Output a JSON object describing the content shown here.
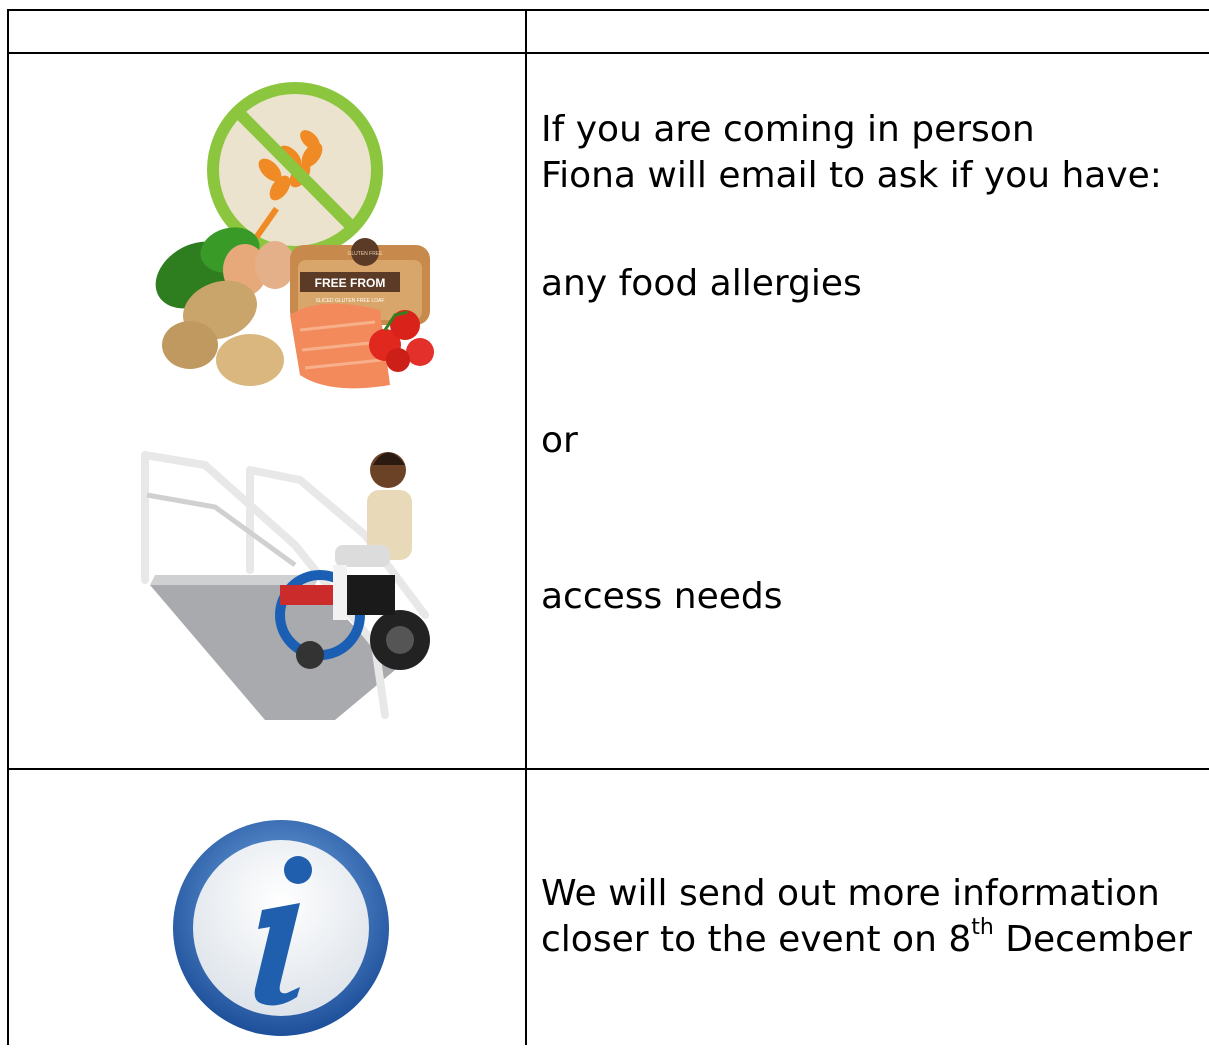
{
  "rows": [
    {
      "lines": [
        "If you are coming in person",
        "Fiona will email to ask if you have:",
        "any food allergies",
        "or",
        "access needs"
      ],
      "images": [
        "gluten-free-food-picture",
        "wheelchair-ramp-picture"
      ],
      "badge_text": "FREE FROM",
      "badge_small": "SLICED GLUTEN FREE LOAF",
      "tag_text": "GLUTEN FREE"
    },
    {
      "lines": [
        "We will send out more information",
        "closer to the event on 8"
      ],
      "superscript": "th",
      "suffix": " December",
      "icon": "info-icon"
    }
  ]
}
